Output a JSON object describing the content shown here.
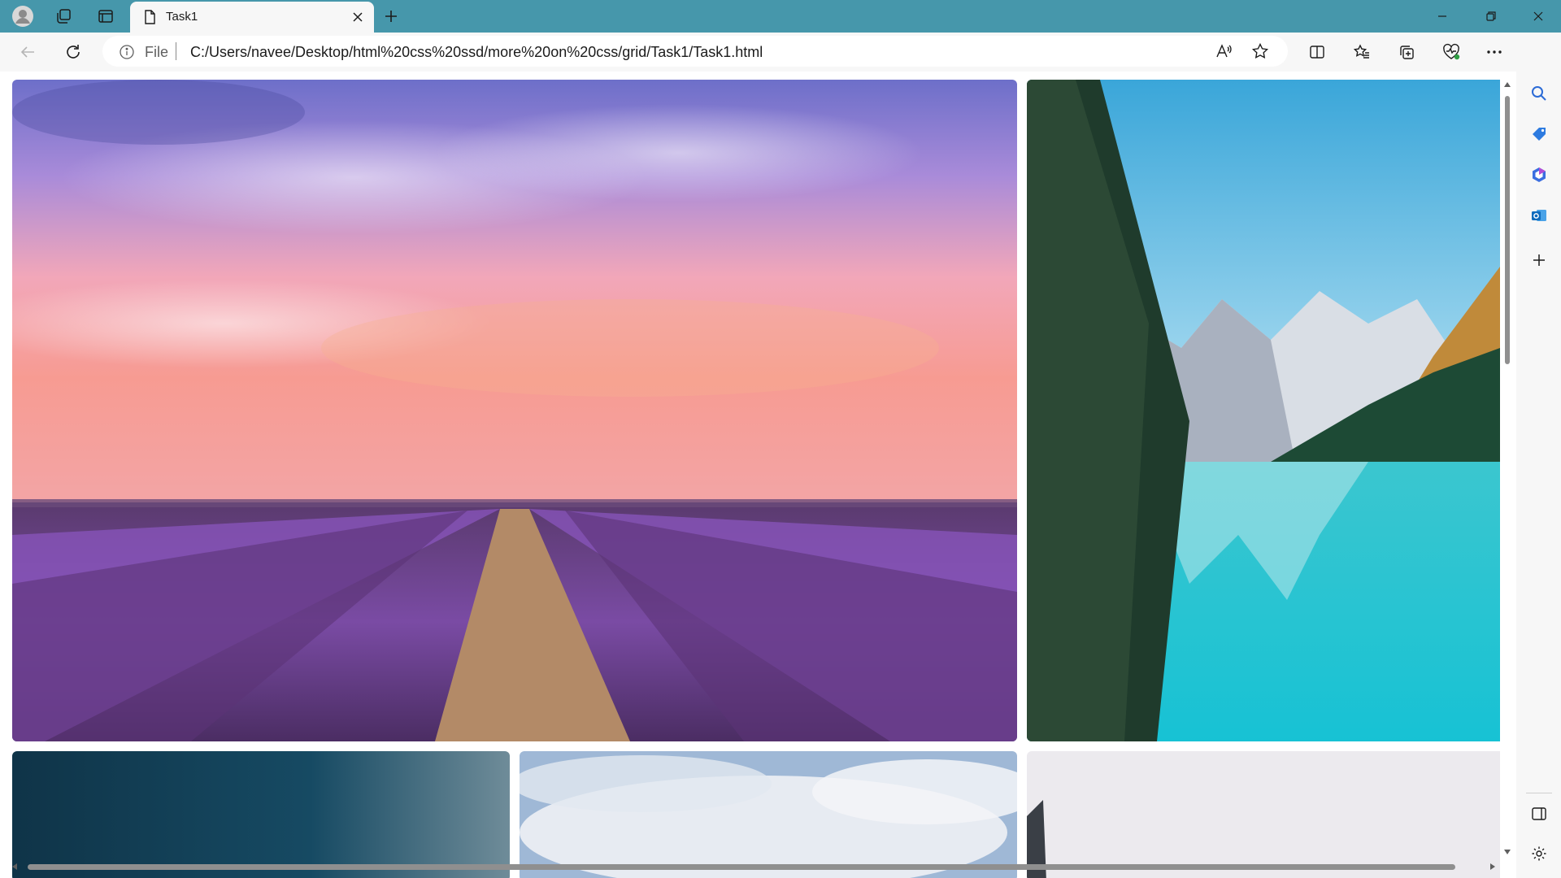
{
  "window": {
    "tab_title": "Task1",
    "icons": [
      "profile-avatar-icon",
      "workspaces-icon",
      "tab-actions-icon",
      "page-icon",
      "close-icon",
      "plus-icon",
      "minimize-icon",
      "restore-icon",
      "close-window-icon"
    ]
  },
  "toolbar": {
    "file_label": "File",
    "url": "C:/Users/navee/Desktop/html%20css%20ssd/more%20on%20css/grid/Task1/Task1.html",
    "icons": [
      "back-icon",
      "refresh-icon",
      "info-icon",
      "read-aloud-icon",
      "favorite-star-icon",
      "split-screen-icon",
      "favorites-icon",
      "collections-icon",
      "browser-essentials-icon",
      "more-icon",
      "copilot-icon"
    ]
  },
  "sidebar": {
    "icons": [
      "search-icon",
      "shopping-tag-icon",
      "microsoft365-icon",
      "outlook-icon",
      "add-icon",
      "hide-sidebar-icon",
      "settings-icon"
    ]
  },
  "gallery": {
    "images": [
      {
        "subject": "lavender field at sunset"
      },
      {
        "subject": "mountain lake with pine trees"
      },
      {
        "subject": "dark blue stormy sky"
      },
      {
        "subject": "white clouds in blue sky"
      },
      {
        "subject": "foggy white landscape"
      }
    ]
  },
  "colors": {
    "titlebar": "#4697ab",
    "toolbar": "#f7f7f7",
    "accent": "#0f6cbd"
  }
}
